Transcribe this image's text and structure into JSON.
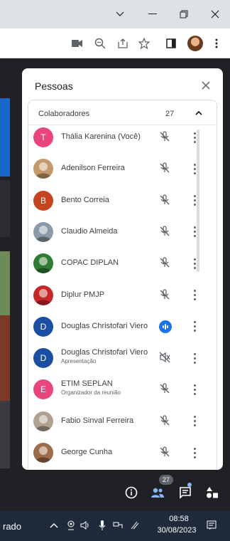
{
  "panel": {
    "title": "Pessoas",
    "section_label": "Colaboradores",
    "section_count": "27"
  },
  "participants": [
    {
      "name": "Thália Karenina (Você)",
      "subtitle": "",
      "initial": "T",
      "avatar_color": "#e8457a",
      "mic": "muted"
    },
    {
      "name": "Adenilson Ferreira",
      "subtitle": "",
      "initial": "",
      "avatar_color": "#c49a6c",
      "mic": "muted"
    },
    {
      "name": "Bento Correia",
      "subtitle": "",
      "initial": "B",
      "avatar_color": "#c5441f",
      "mic": "muted"
    },
    {
      "name": "Claudio Almeida",
      "subtitle": "",
      "initial": "",
      "avatar_color": "#8a9aa8",
      "mic": "muted"
    },
    {
      "name": "COPAC DIPLAN",
      "subtitle": "",
      "initial": "",
      "avatar_color": "#2e7d32",
      "mic": "muted"
    },
    {
      "name": "Diplur PMJP",
      "subtitle": "",
      "initial": "",
      "avatar_color": "#c62828",
      "mic": "muted"
    },
    {
      "name": "Douglas Christofari Viero",
      "subtitle": "",
      "initial": "D",
      "avatar_color": "#1a4fa3",
      "mic": "speaking"
    },
    {
      "name": "Douglas Christofari Viero",
      "subtitle": "Apresentação",
      "initial": "D",
      "avatar_color": "#1a4fa3",
      "mic": "presenting"
    },
    {
      "name": "ETIM SEPLAN",
      "subtitle": "Organizador da reunião",
      "initial": "E",
      "avatar_color": "#e8457a",
      "mic": "muted"
    },
    {
      "name": "Fabio Sinval Ferreira",
      "subtitle": "",
      "initial": "",
      "avatar_color": "#b0a090",
      "mic": "muted"
    },
    {
      "name": "George Cunha",
      "subtitle": "",
      "initial": "",
      "avatar_color": "#9c6b4a",
      "mic": "muted"
    }
  ],
  "controls": {
    "people_badge": "27"
  },
  "taskbar": {
    "text": "rado",
    "time": "08:58",
    "date": "30/08/2023"
  },
  "icons": [
    "chevron-down-icon",
    "minimize-icon",
    "restore-icon",
    "close-icon",
    "camera-icon",
    "zoom-icon",
    "share-icon",
    "star-icon",
    "sidepanel-icon",
    "kebab-icon",
    "mic-off-icon",
    "more-vert-icon",
    "info-icon",
    "people-icon",
    "chat-icon",
    "activities-icon"
  ]
}
